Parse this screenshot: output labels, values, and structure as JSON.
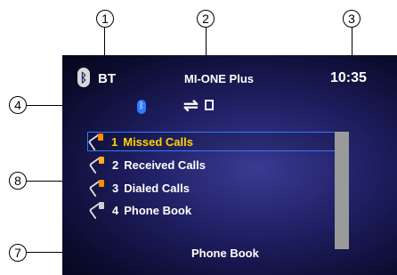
{
  "callouts": {
    "one": "1",
    "two": "2",
    "three": "3",
    "four": "4",
    "seven": "7",
    "eight": "8"
  },
  "header": {
    "connection_label": "BT",
    "device_name": "MI-ONE Plus",
    "time": "10:35"
  },
  "menu": {
    "items": [
      {
        "number": "1",
        "label": "Missed Calls"
      },
      {
        "number": "2",
        "label": "Received Calls"
      },
      {
        "number": "3",
        "label": "Dialed Calls"
      },
      {
        "number": "4",
        "label": "Phone Book"
      }
    ]
  },
  "footer": {
    "label": "Phone Book"
  },
  "colors": {
    "accent": "#ffd400",
    "highlight_border": "#2f7bff",
    "bluetooth": "#2f7bff"
  }
}
